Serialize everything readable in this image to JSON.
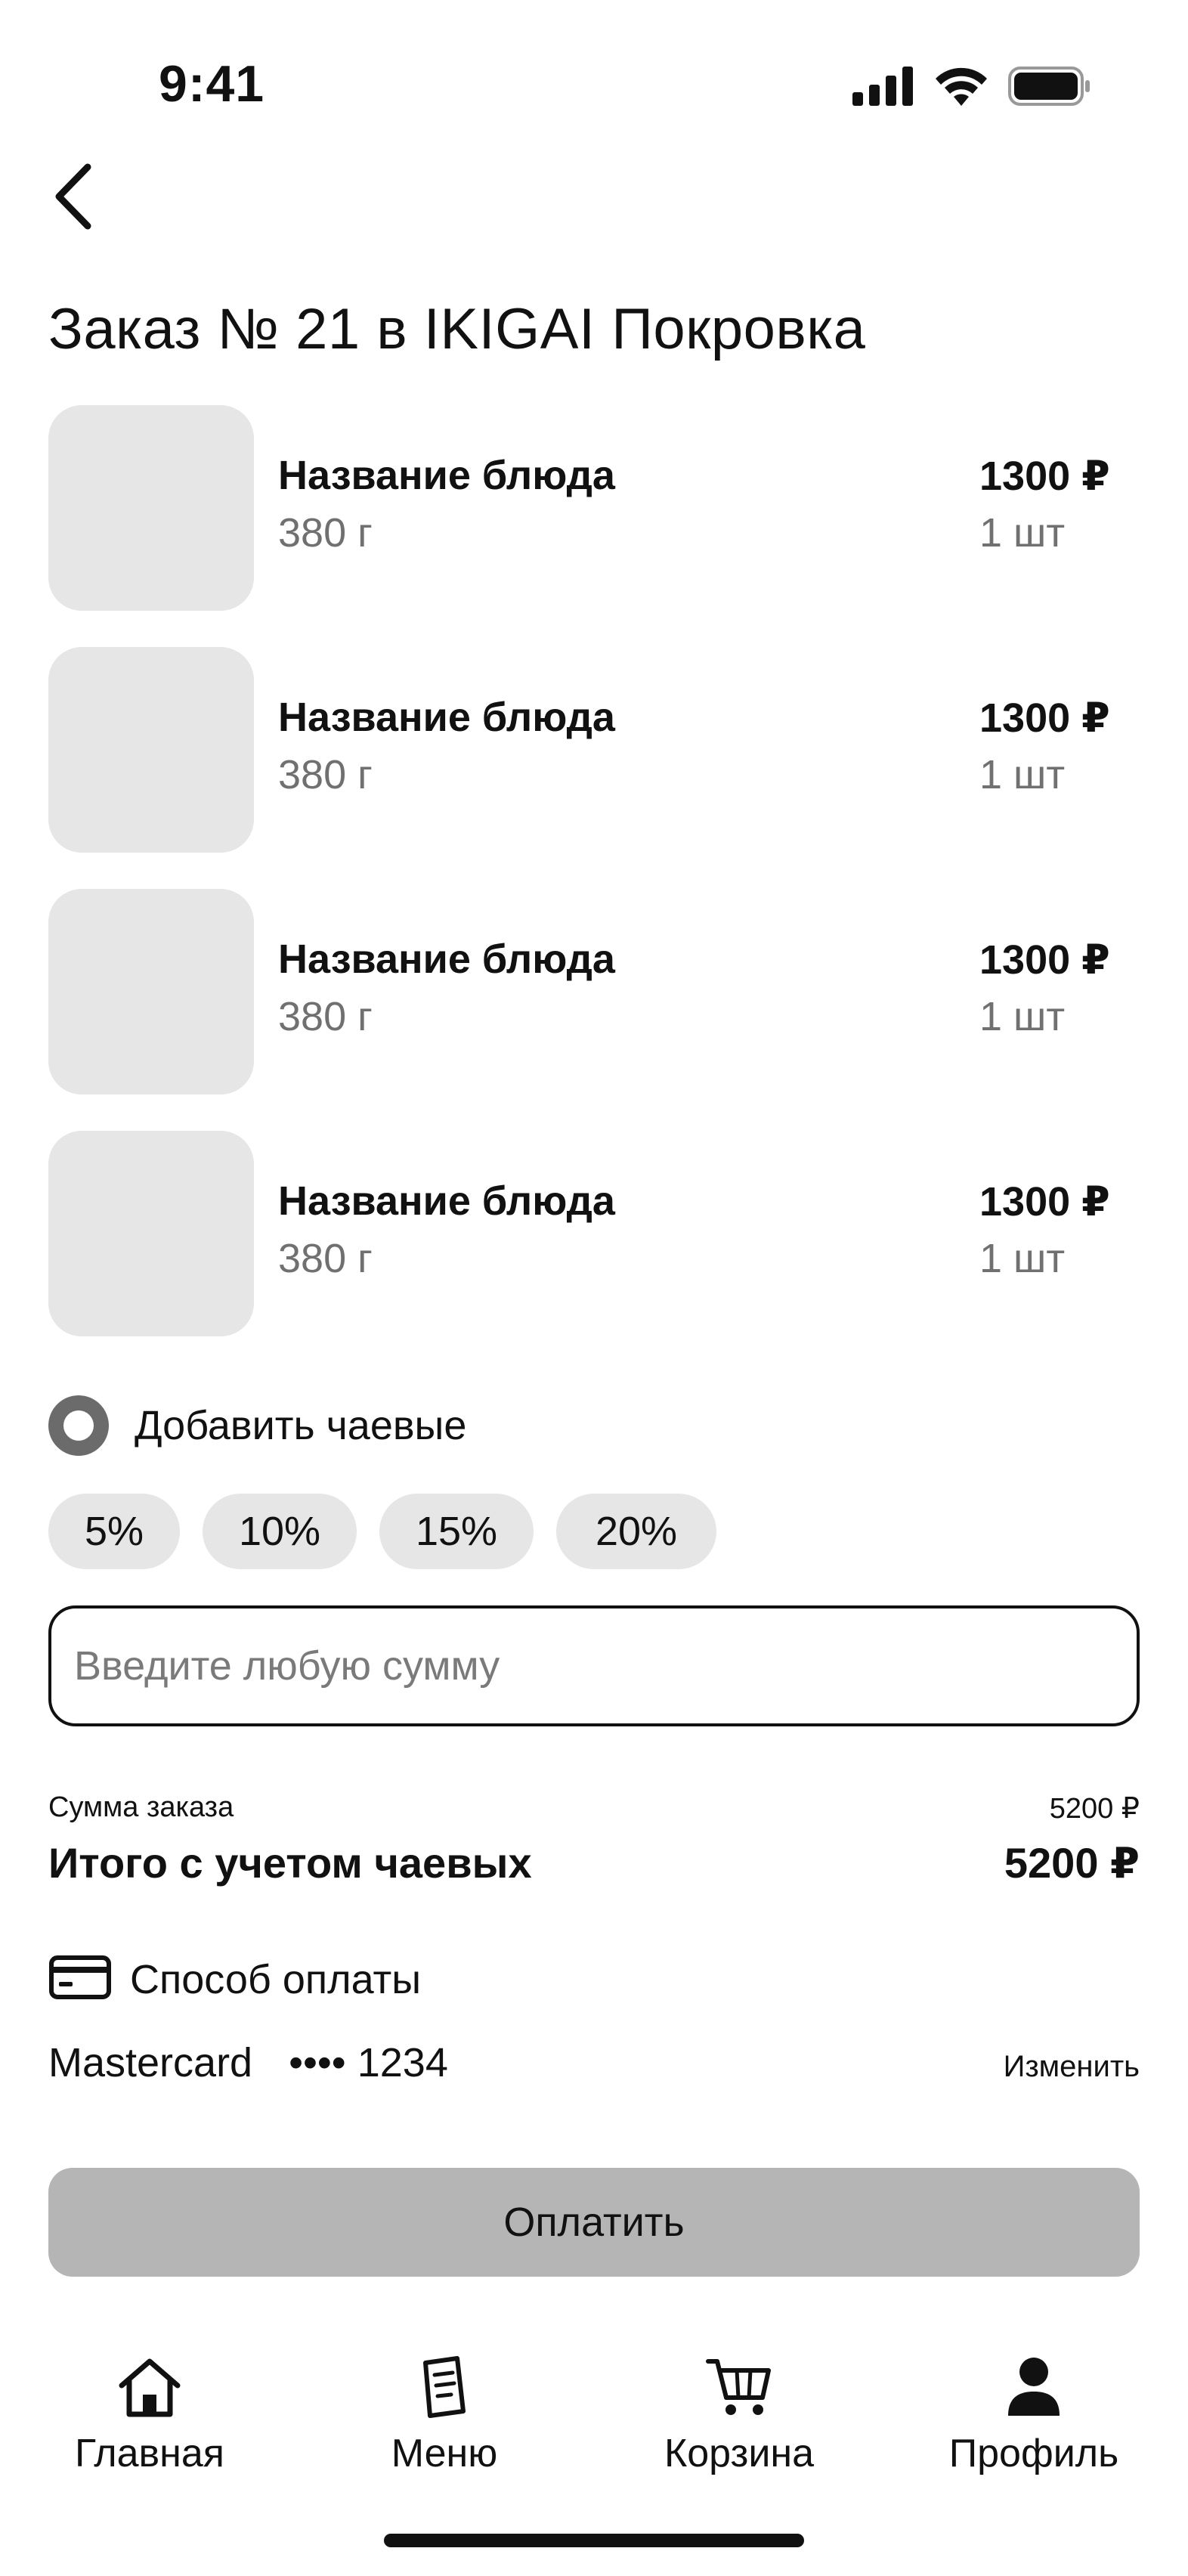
{
  "status_bar": {
    "time": "9:41",
    "icons": [
      "signal-icon",
      "wifi-icon",
      "battery-icon"
    ]
  },
  "header": {
    "back_icon": "chevron-left-icon",
    "title": "Заказ № 21 в IKIGAI Покровка"
  },
  "items": [
    {
      "name": "Название блюда",
      "weight": "380 г",
      "price": "1300 ₽",
      "qty": "1 шт"
    },
    {
      "name": "Название блюда",
      "weight": "380 г",
      "price": "1300 ₽",
      "qty": "1 шт"
    },
    {
      "name": "Название блюда",
      "weight": "380 г",
      "price": "1300 ₽",
      "qty": "1 шт"
    },
    {
      "name": "Название блюда",
      "weight": "380 г",
      "price": "1300 ₽",
      "qty": "1 шт"
    }
  ],
  "tips": {
    "toggle_label": "Добавить чаевые",
    "options": [
      "5%",
      "10%",
      "15%",
      "20%"
    ],
    "input_placeholder": "Введите любую сумму"
  },
  "summary": {
    "order_sum_label": "Сумма заказа",
    "order_sum_value": "5200 ₽",
    "total_label": "Итого с учетом чаевых",
    "total_value": "5200 ₽"
  },
  "payment": {
    "method_label": "Способ оплаты",
    "method_icon": "credit-card-icon",
    "card_brand": "Mastercard",
    "card_number": "•••• 1234",
    "change_label": "Изменить",
    "pay_button": "Оплатить"
  },
  "tab_bar": {
    "tabs": [
      {
        "label": "Главная",
        "icon": "home-icon"
      },
      {
        "label": "Меню",
        "icon": "menu-book-icon"
      },
      {
        "label": "Корзина",
        "icon": "cart-icon"
      },
      {
        "label": "Профиль",
        "icon": "profile-icon"
      }
    ]
  },
  "colors": {
    "text": "#111111",
    "secondary_text": "#707070",
    "placeholder_fill": "#e6e6e6",
    "disabled_button": "#b5b5b5"
  }
}
